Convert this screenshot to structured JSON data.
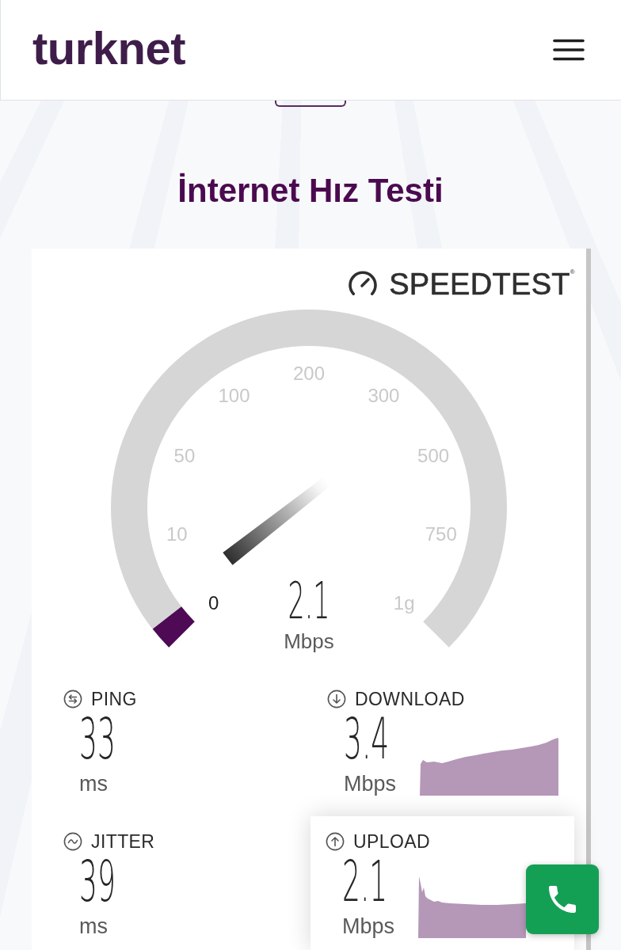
{
  "header": {
    "logo": "turknet"
  },
  "title": "İnternet Hız Testi",
  "speedtest_card": {
    "brand": "SPEEDTEST$^{®}$",
    "gauge": {
      "scale": [
        {
          "label": "0",
          "passed": true
        },
        {
          "label": "10",
          "passed": false
        },
        {
          "label": "50",
          "passed": false
        },
        {
          "label": "100",
          "passed": false
        },
        {
          "label": "200",
          "passed": false
        },
        {
          "label": "300",
          "passed": false
        },
        {
          "label": "500",
          "passed": false
        },
        {
          "label": "750",
          "passed": false
        },
        {
          "label": "1g",
          "passed": false
        }
      ],
      "segment_fill": {
        "level": 0.21
      },
      "value": "2.1",
      "unit": "Mbps"
    },
    "stats": [
      {
        "kind": "ping",
        "label": "PING",
        "value": "33",
        "unit": "ms",
        "active": false
      },
      {
        "kind": "download",
        "label": "DOWNLOAD",
        "value": "3.4",
        "unit": "Mbps",
        "active": false
      },
      {
        "kind": "jitter",
        "label": "JITTER",
        "value": "39",
        "unit": "ms",
        "active": false
      },
      {
        "kind": "upload",
        "label": "UPLOAD",
        "value": "2.1",
        "unit": "Mbps",
        "active": true
      }
    ]
  }
}
